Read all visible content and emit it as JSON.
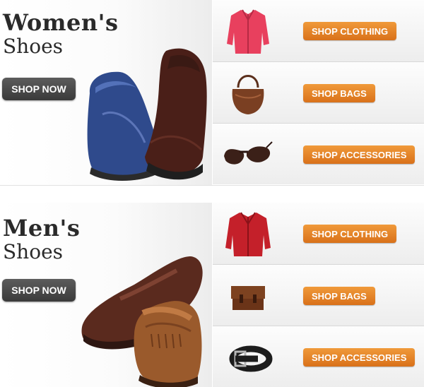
{
  "women": {
    "title_bold": "Women's",
    "title_light": "Shoes",
    "cta": "SHOP NOW",
    "rows": [
      {
        "label": "SHOP CLOTHING",
        "thumb": "pink-jacket"
      },
      {
        "label": "SHOP BAGS",
        "thumb": "brown-handbag"
      },
      {
        "label": "SHOP ACCESSORIES",
        "thumb": "sunglasses"
      }
    ]
  },
  "men": {
    "title_bold": "Men's",
    "title_light": "Shoes",
    "cta": "SHOP NOW",
    "rows": [
      {
        "label": "SHOP CLOTHING",
        "thumb": "red-fleece-jacket"
      },
      {
        "label": "SHOP BAGS",
        "thumb": "leather-messenger-bag"
      },
      {
        "label": "SHOP ACCESSORIES",
        "thumb": "black-belt"
      }
    ]
  },
  "colors": {
    "accent_orange": "#e0801f",
    "cta_dark": "#474747",
    "title_text": "#2a2a2a"
  }
}
